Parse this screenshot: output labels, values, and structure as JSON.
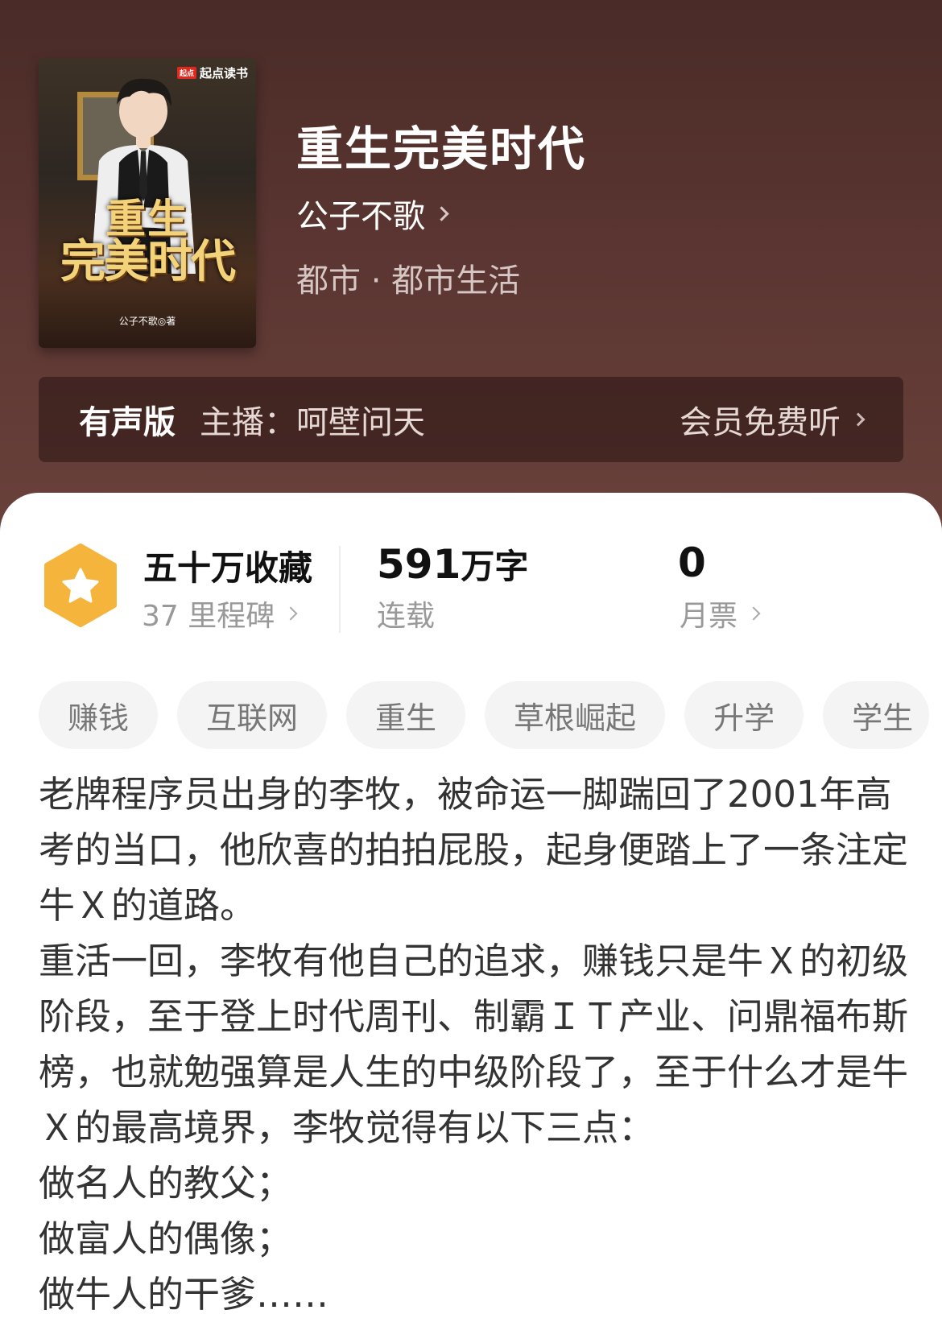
{
  "book": {
    "cover": {
      "brand": "起点读书",
      "brand_badge": "起点",
      "title_line1": "重生",
      "title_line2": "完美时代",
      "author_credit": "公子不歌◎著"
    },
    "title": "重生完美时代",
    "author": "公子不歌",
    "genre": "都市 · 都市生活"
  },
  "audio": {
    "label": "有声版",
    "host": "主播：呵壁问天",
    "vip": "会员免费听"
  },
  "stats": {
    "collect_main": "五十万收藏",
    "collect_sub": "37 里程碑",
    "words_num": "591",
    "words_unit": "万字",
    "words_sub": "连载",
    "ticket_main": "0",
    "ticket_sub": "月票"
  },
  "tags": [
    "赚钱",
    "互联网",
    "重生",
    "草根崛起",
    "升学",
    "学生"
  ],
  "description": [
    "老牌程序员出身的李牧，被命运一脚踹回了2001年高考的当口，他欣喜的拍拍屁股，起身便踏上了一条注定牛Ｘ的道路。",
    "重活一回，李牧有他自己的追求，赚钱只是牛Ｘ的初级阶段，至于登上时代周刊、制霸ＩＴ产业、问鼎福布斯榜，也就勉强算是人生的中级阶段了，至于什么才是牛Ｘ的最高境界，李牧觉得有以下三点：",
    "做名人的教父；",
    "做富人的偶像；",
    "做牛人的干爹……"
  ],
  "colors": {
    "header": "#5a3531",
    "badge": "#f5b43c"
  },
  "icons": {
    "collect": "star-hexagon-icon"
  }
}
